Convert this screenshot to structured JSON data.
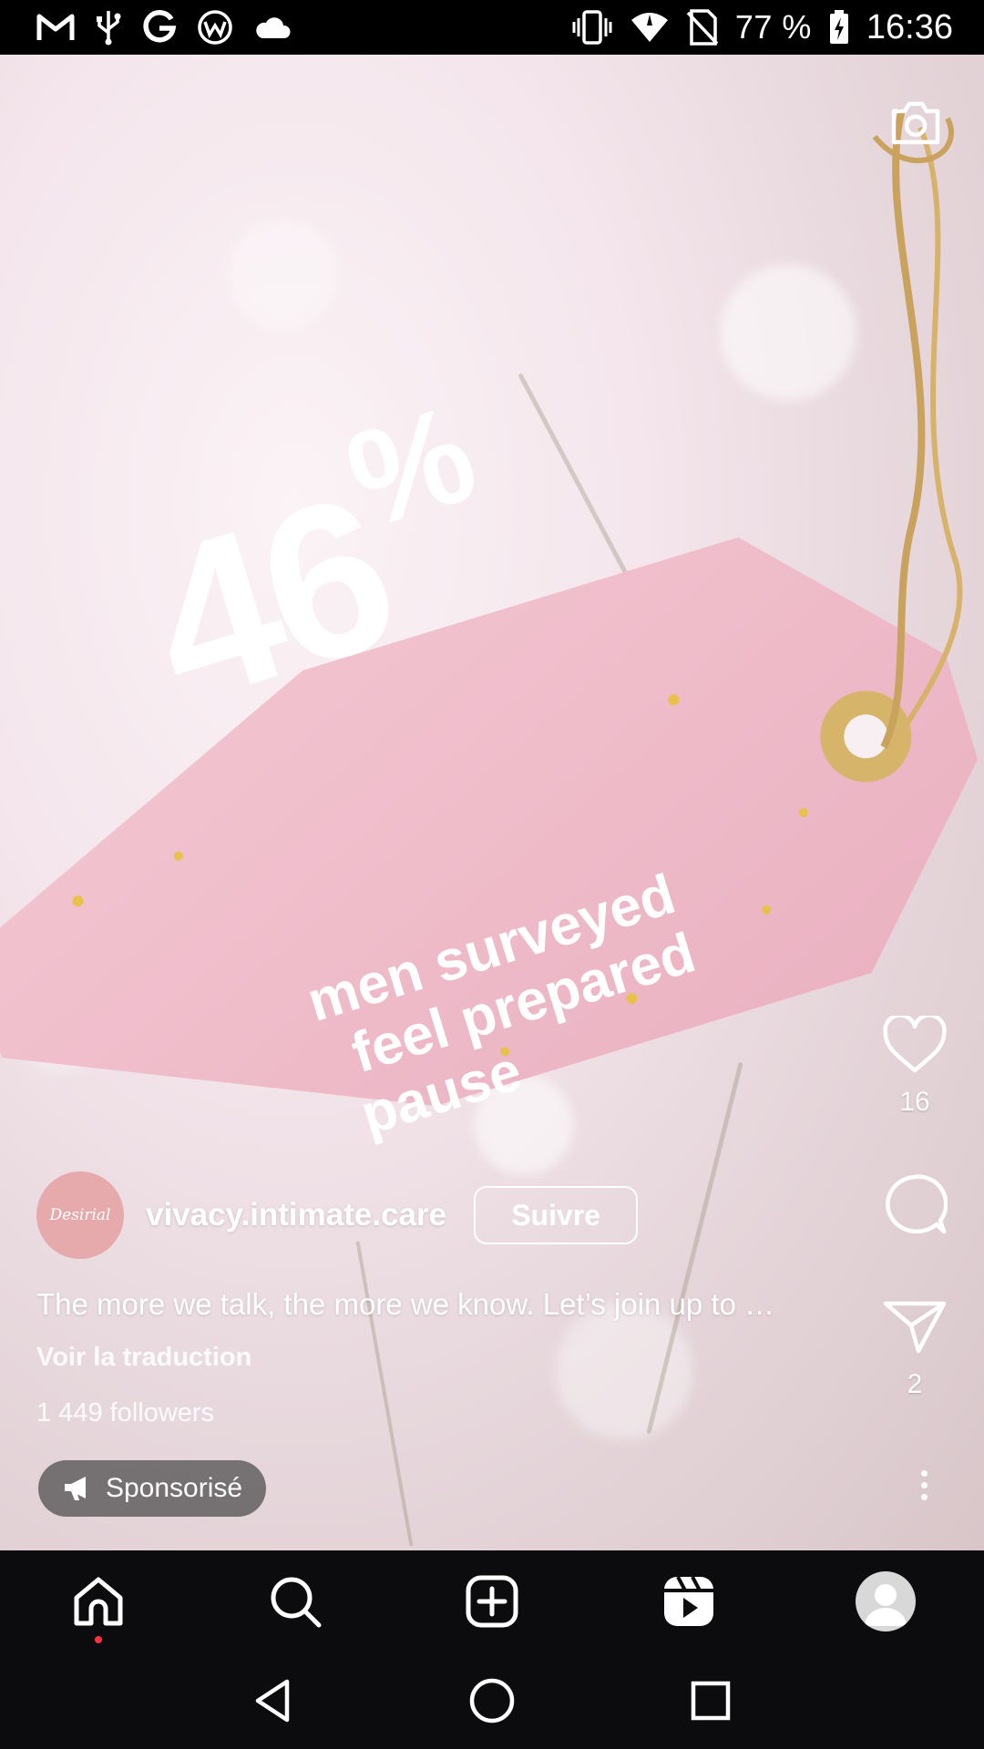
{
  "status_bar": {
    "battery_text": "77 %",
    "time": "16:36",
    "left_icons": [
      "gmail-icon",
      "usb-icon",
      "google-icon",
      "app-icon",
      "cloud-icon"
    ],
    "right_icons": [
      "vibrate-icon",
      "wifi-icon",
      "no-sim-icon",
      "battery-charging-icon"
    ]
  },
  "media": {
    "tag_big": "46",
    "tag_percent": "%",
    "tag_lines": [
      "men surveyed",
      "feel prepared",
      "pause"
    ]
  },
  "actions": {
    "like_count": "16",
    "share_count": "2"
  },
  "post": {
    "avatar_text": "Desirial",
    "username": "vivacy.intimate.care",
    "follow_label": "Suivre",
    "caption": "The more we talk, the more we know. Let’s join up to …",
    "translate_label": "Voir la traduction",
    "followers": "1 449 followers",
    "sponsored_label": "Sponsorisé"
  },
  "bottom_nav": {
    "items": [
      "home-icon",
      "search-icon",
      "create-icon",
      "reels-icon",
      "profile-avatar"
    ]
  },
  "colors": {
    "accent_notification": "#ff3040",
    "tag_pink": "#f0bccb",
    "nav_bg": "#0c0c0e"
  }
}
